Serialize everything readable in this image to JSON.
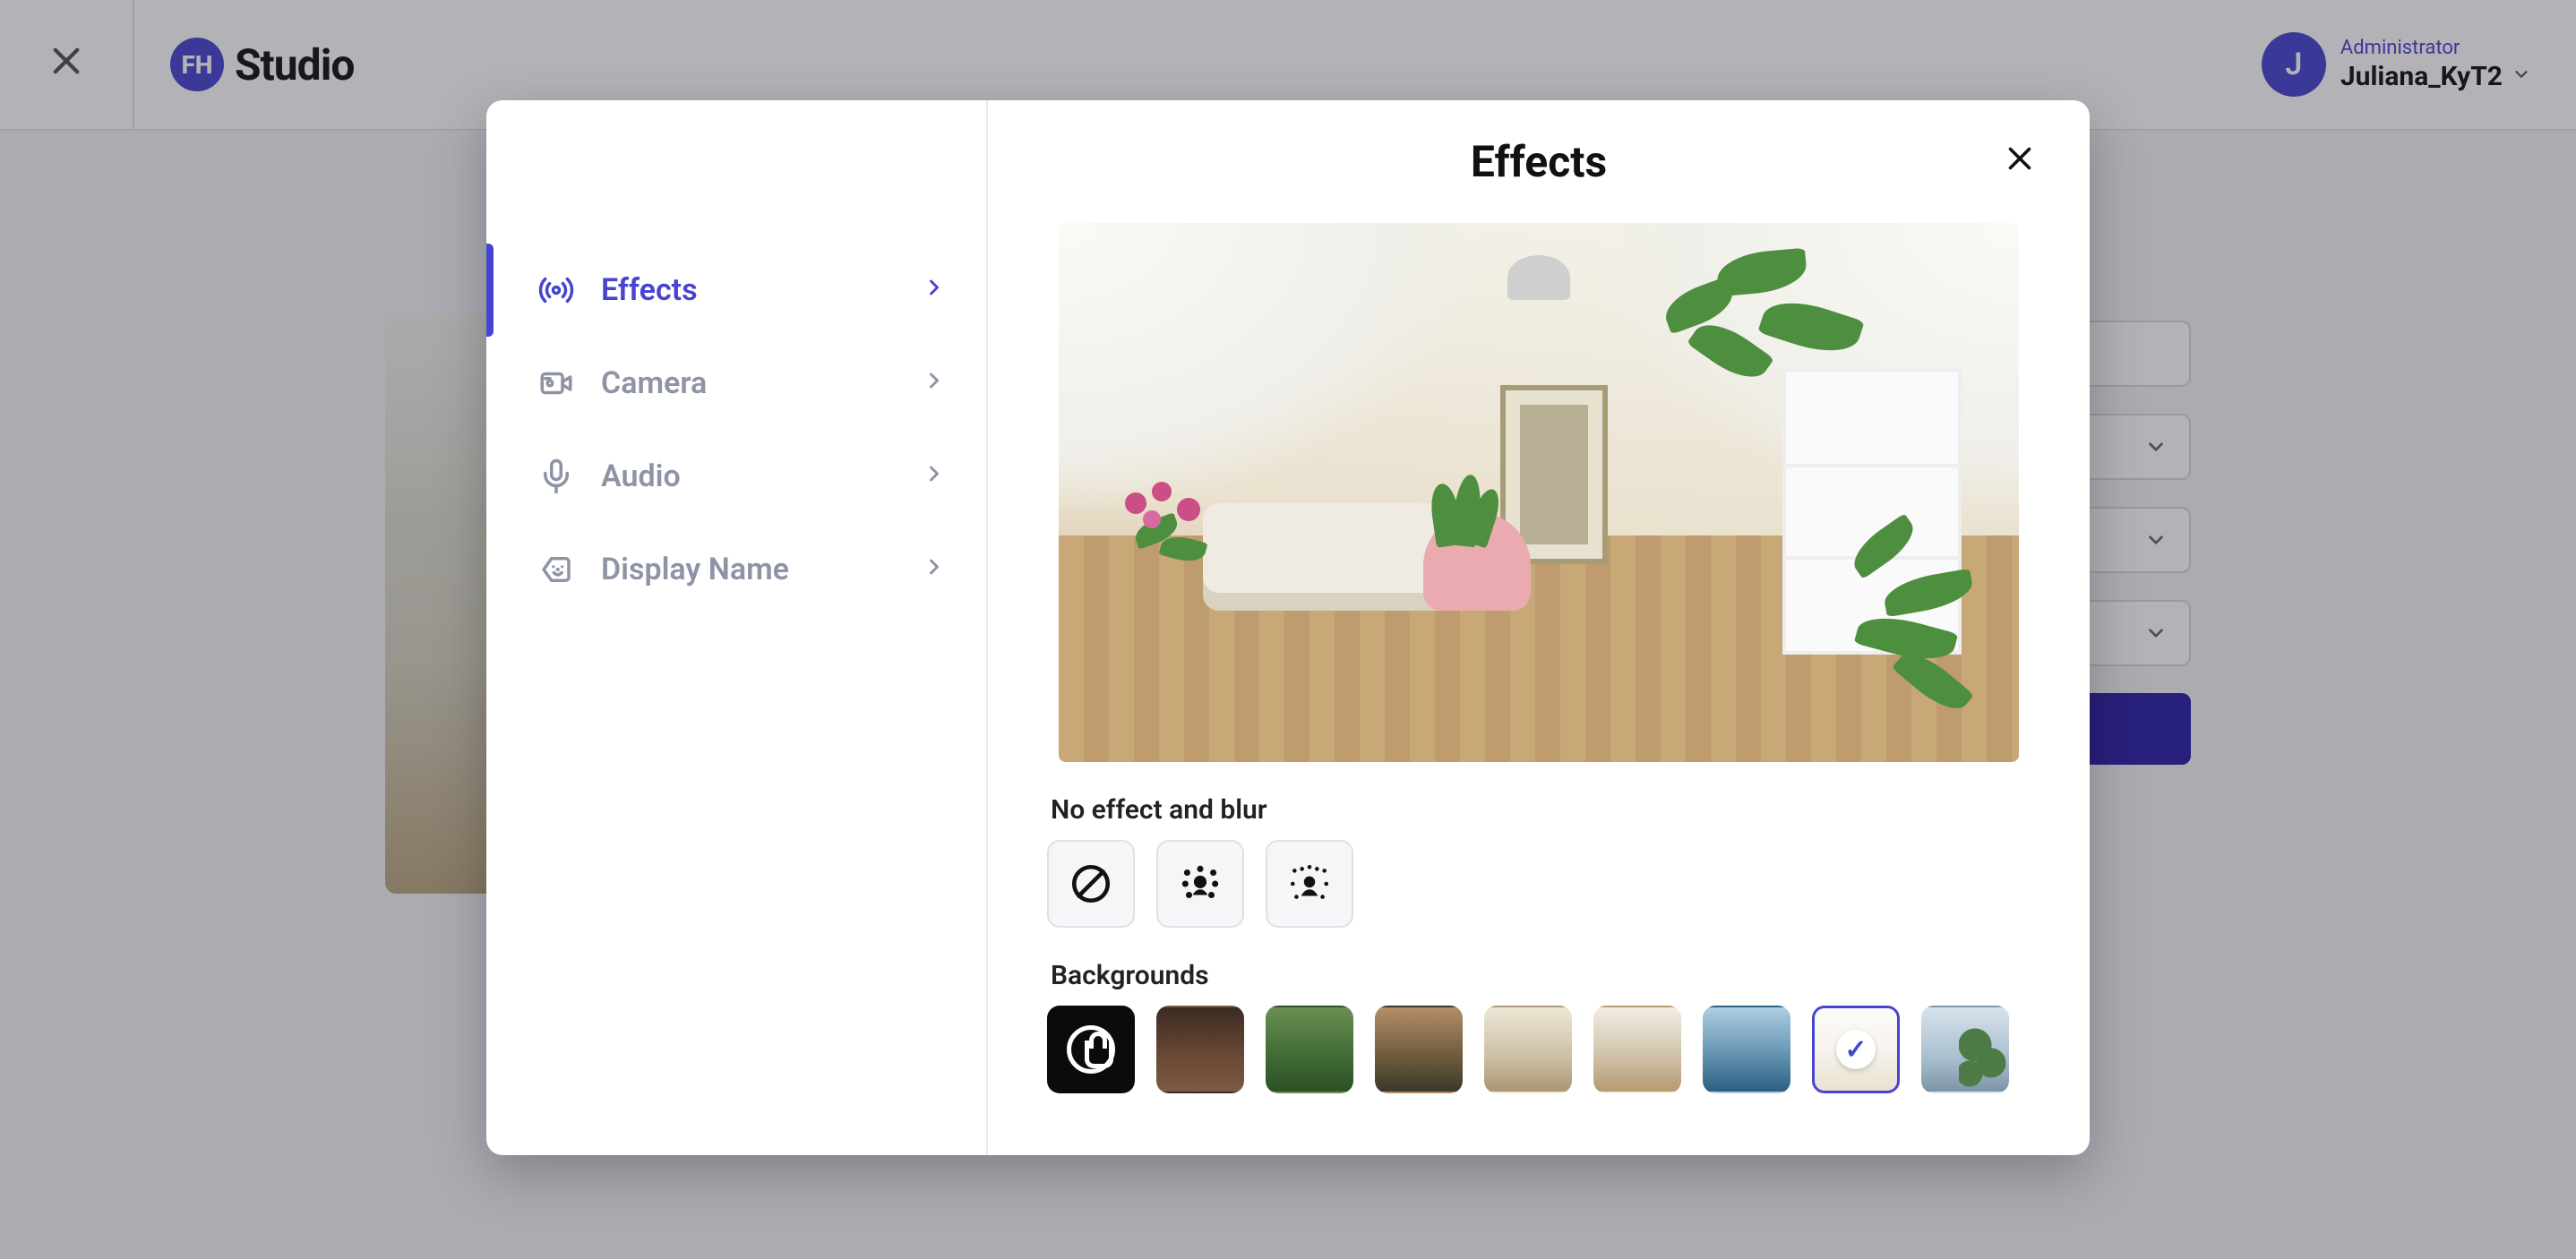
{
  "brand": {
    "logo_letters": "FH",
    "name": "Studio"
  },
  "user": {
    "role": "Administrator",
    "name": "Juliana_KyT2",
    "avatar_initial": "J"
  },
  "bg_form": {
    "button_label": ""
  },
  "modal": {
    "title": "Effects",
    "sidebar": {
      "items": [
        {
          "key": "effects",
          "label": "Effects",
          "active": true
        },
        {
          "key": "camera",
          "label": "Camera",
          "active": false
        },
        {
          "key": "audio",
          "label": "Audio",
          "active": false
        },
        {
          "key": "display-name",
          "label": "Display Name",
          "active": false
        }
      ]
    },
    "sections": {
      "blur_label": "No effect and blur",
      "backgrounds_label": "Backgrounds"
    },
    "blur_options": [
      {
        "key": "none",
        "name": "no-effect"
      },
      {
        "key": "blur-light",
        "name": "blur-light"
      },
      {
        "key": "blur-strong",
        "name": "blur-strong"
      }
    ],
    "backgrounds": [
      {
        "key": "brand-dark",
        "selected": false
      },
      {
        "key": "brick",
        "selected": false
      },
      {
        "key": "forest",
        "selected": false
      },
      {
        "key": "hills",
        "selected": false
      },
      {
        "key": "library",
        "selected": false
      },
      {
        "key": "living",
        "selected": false
      },
      {
        "key": "ocean",
        "selected": false
      },
      {
        "key": "studio",
        "selected": true
      },
      {
        "key": "palm",
        "selected": false
      }
    ],
    "colors": {
      "accent": "#4745d0",
      "muted": "#8e93a6"
    }
  }
}
